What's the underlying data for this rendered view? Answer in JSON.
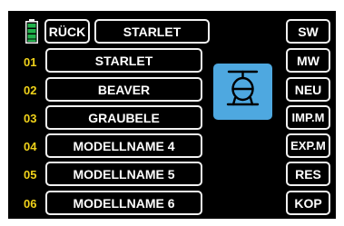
{
  "header": {
    "back_label": "RÜCK",
    "current_model": "STARLET"
  },
  "models": [
    {
      "number": "01",
      "name": "STARLET"
    },
    {
      "number": "02",
      "name": "BEAVER"
    },
    {
      "number": "03",
      "name": "GRAUBELE"
    },
    {
      "number": "04",
      "name": "MODELLNAME 4"
    },
    {
      "number": "05",
      "name": "MODELLNAME 5"
    },
    {
      "number": "06",
      "name": "MODELLNAME 6"
    }
  ],
  "side_buttons": [
    "SW",
    "MW",
    "NEU",
    "IMP.M",
    "EXP.M",
    "RES",
    "KOP"
  ],
  "icons": {
    "battery": "battery-icon",
    "model_type": "helicopter-icon"
  },
  "colors": {
    "background": "#000000",
    "button_border": "#f2f2f2",
    "row_number": "#f0d21a",
    "battery": "#22b14c",
    "model_icon_bg": "#4ea8e0"
  }
}
